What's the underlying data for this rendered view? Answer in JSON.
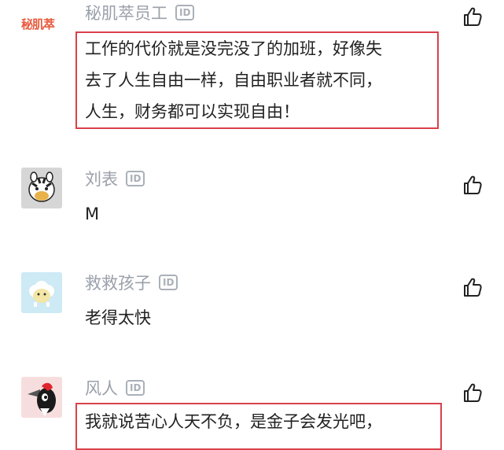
{
  "comments": [
    {
      "username": "秘肌萃员工",
      "badge": "ID",
      "avatar_logo_text": "秘肌萃",
      "lines": [
        "工作的代价就是没完没了的加班，好像失",
        "去了人生自由一样，自由职业者就不同，",
        "人生，财务都可以实现自由！"
      ]
    },
    {
      "username": "刘表",
      "badge": "ID",
      "lines": [
        "M"
      ]
    },
    {
      "username": "救救孩子",
      "badge": "ID",
      "lines": [
        "老得太快"
      ]
    },
    {
      "username": "风人",
      "badge": "ID",
      "lines": [
        "我就说苦心人天不负，是金子会发光吧，"
      ]
    }
  ],
  "colors": {
    "highlight": "#d9414b",
    "username": "#9aa0aa",
    "text": "#222222",
    "logo": "#e8593c"
  },
  "icons": {
    "like": "thumbs-up-icon"
  }
}
